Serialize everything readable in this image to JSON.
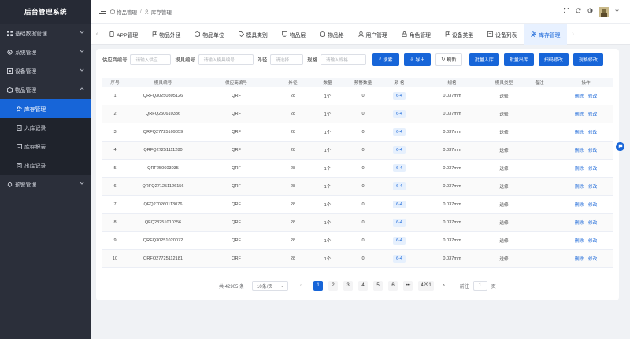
{
  "app": {
    "title": "后台管理系统"
  },
  "sidebar": {
    "items": [
      {
        "label": "基础数据管理",
        "icon": "grid-icon",
        "expanded": false
      },
      {
        "label": "系统管理",
        "icon": "settings-icon",
        "expanded": false
      },
      {
        "label": "设备管理",
        "icon": "device-icon",
        "expanded": false
      },
      {
        "label": "物品管理",
        "icon": "goods-icon",
        "expanded": true
      },
      {
        "label": "预警管理",
        "icon": "bell-icon",
        "expanded": false
      }
    ],
    "subitems": [
      {
        "label": "库存管理",
        "icon": "users-icon",
        "active": true
      },
      {
        "label": "入库记录",
        "icon": "document-icon",
        "active": false
      },
      {
        "label": "库存报表",
        "icon": "report-icon",
        "active": false
      },
      {
        "label": "出库记录",
        "icon": "document-icon",
        "active": false
      }
    ]
  },
  "header": {
    "breadcrumb": [
      "物品管理",
      "库存管理"
    ],
    "icons": [
      "fullscreen-icon",
      "refresh-icon",
      "theme-icon",
      "avatar"
    ]
  },
  "tabs": [
    {
      "label": "APP管理",
      "icon": "phone-icon"
    },
    {
      "label": "物品外径",
      "icon": "flag-icon"
    },
    {
      "label": "物品单位",
      "icon": "box-icon"
    },
    {
      "label": "模具类别",
      "icon": "tag-icon"
    },
    {
      "label": "物品层",
      "icon": "monitor-icon"
    },
    {
      "label": "物品格",
      "icon": "box-icon"
    },
    {
      "label": "用户管理",
      "icon": "user-icon"
    },
    {
      "label": "角色管理",
      "icon": "lock-icon"
    },
    {
      "label": "设备类型",
      "icon": "flag-icon"
    },
    {
      "label": "设备列表",
      "icon": "list-icon"
    },
    {
      "label": "库存管理",
      "icon": "users-icon",
      "active": true
    }
  ],
  "filters": {
    "supplier": {
      "label": "供应商编号",
      "placeholder": "请输入供应"
    },
    "mold": {
      "label": "模具编号",
      "placeholder": "请输入模具编号"
    },
    "diameter": {
      "label": "外径",
      "placeholder": "请选择"
    },
    "spec": {
      "label": "规格",
      "placeholder": "请输入规格"
    }
  },
  "buttons": {
    "search": "搜索",
    "export": "导出",
    "refresh": "刷新",
    "batch_in": "批量入库",
    "batch_out": "批量出库",
    "scan_edit": "扫码修改",
    "spec_edit": "规格修改"
  },
  "table": {
    "columns": [
      "序号",
      "模具编号",
      "供应商编号",
      "外径",
      "数量",
      "预警数量",
      "颜-格",
      "规格",
      "模具类型",
      "备注",
      "操作"
    ],
    "rows": [
      [
        "1",
        "QRFQ30250805126",
        "QRF",
        "28",
        "1个",
        "0",
        "6-4",
        "0.037mm",
        "送修",
        ""
      ],
      [
        "2",
        "QRFQ250610336",
        "QRF",
        "28",
        "1个",
        "0",
        "6-4",
        "0.037mm",
        "送修",
        ""
      ],
      [
        "3",
        "QRFQ27725109059",
        "QRF",
        "28",
        "1个",
        "0",
        "6-4",
        "0.037mm",
        "送修",
        ""
      ],
      [
        "4",
        "QRFQ27251111280",
        "QRF",
        "28",
        "1个",
        "0",
        "6-4",
        "0.037mm",
        "送修",
        ""
      ],
      [
        "5",
        "QRF250603035",
        "QRF",
        "28",
        "1个",
        "0",
        "6-4",
        "0.037mm",
        "送修",
        ""
      ],
      [
        "6",
        "QRFQ271251126156",
        "QRF",
        "28",
        "1个",
        "0",
        "6-4",
        "0.037mm",
        "送修",
        ""
      ],
      [
        "7",
        "QFQ270260113076",
        "QRF",
        "28",
        "1个",
        "0",
        "6-4",
        "0.037mm",
        "送修",
        ""
      ],
      [
        "8",
        "QFQ28251010356",
        "QRF",
        "28",
        "1个",
        "0",
        "6-4",
        "0.037mm",
        "送修",
        ""
      ],
      [
        "9",
        "QRFQ30251020072",
        "QRF",
        "28",
        "1个",
        "0",
        "6-4",
        "0.037mm",
        "送修",
        ""
      ],
      [
        "10",
        "QRFQ27725112181",
        "QRF",
        "28",
        "1个",
        "0",
        "6-4",
        "0.037mm",
        "送修",
        ""
      ]
    ],
    "actions": {
      "delete": "删除",
      "edit": "修改"
    }
  },
  "pagination": {
    "total_text": "共 42905 条",
    "page_size": "10条/页",
    "pages": [
      "1",
      "2",
      "3",
      "4",
      "5",
      "6",
      "•••",
      "4291"
    ],
    "current": "1",
    "goto_label": "前往",
    "goto_value": "1",
    "page_suffix": "页"
  }
}
